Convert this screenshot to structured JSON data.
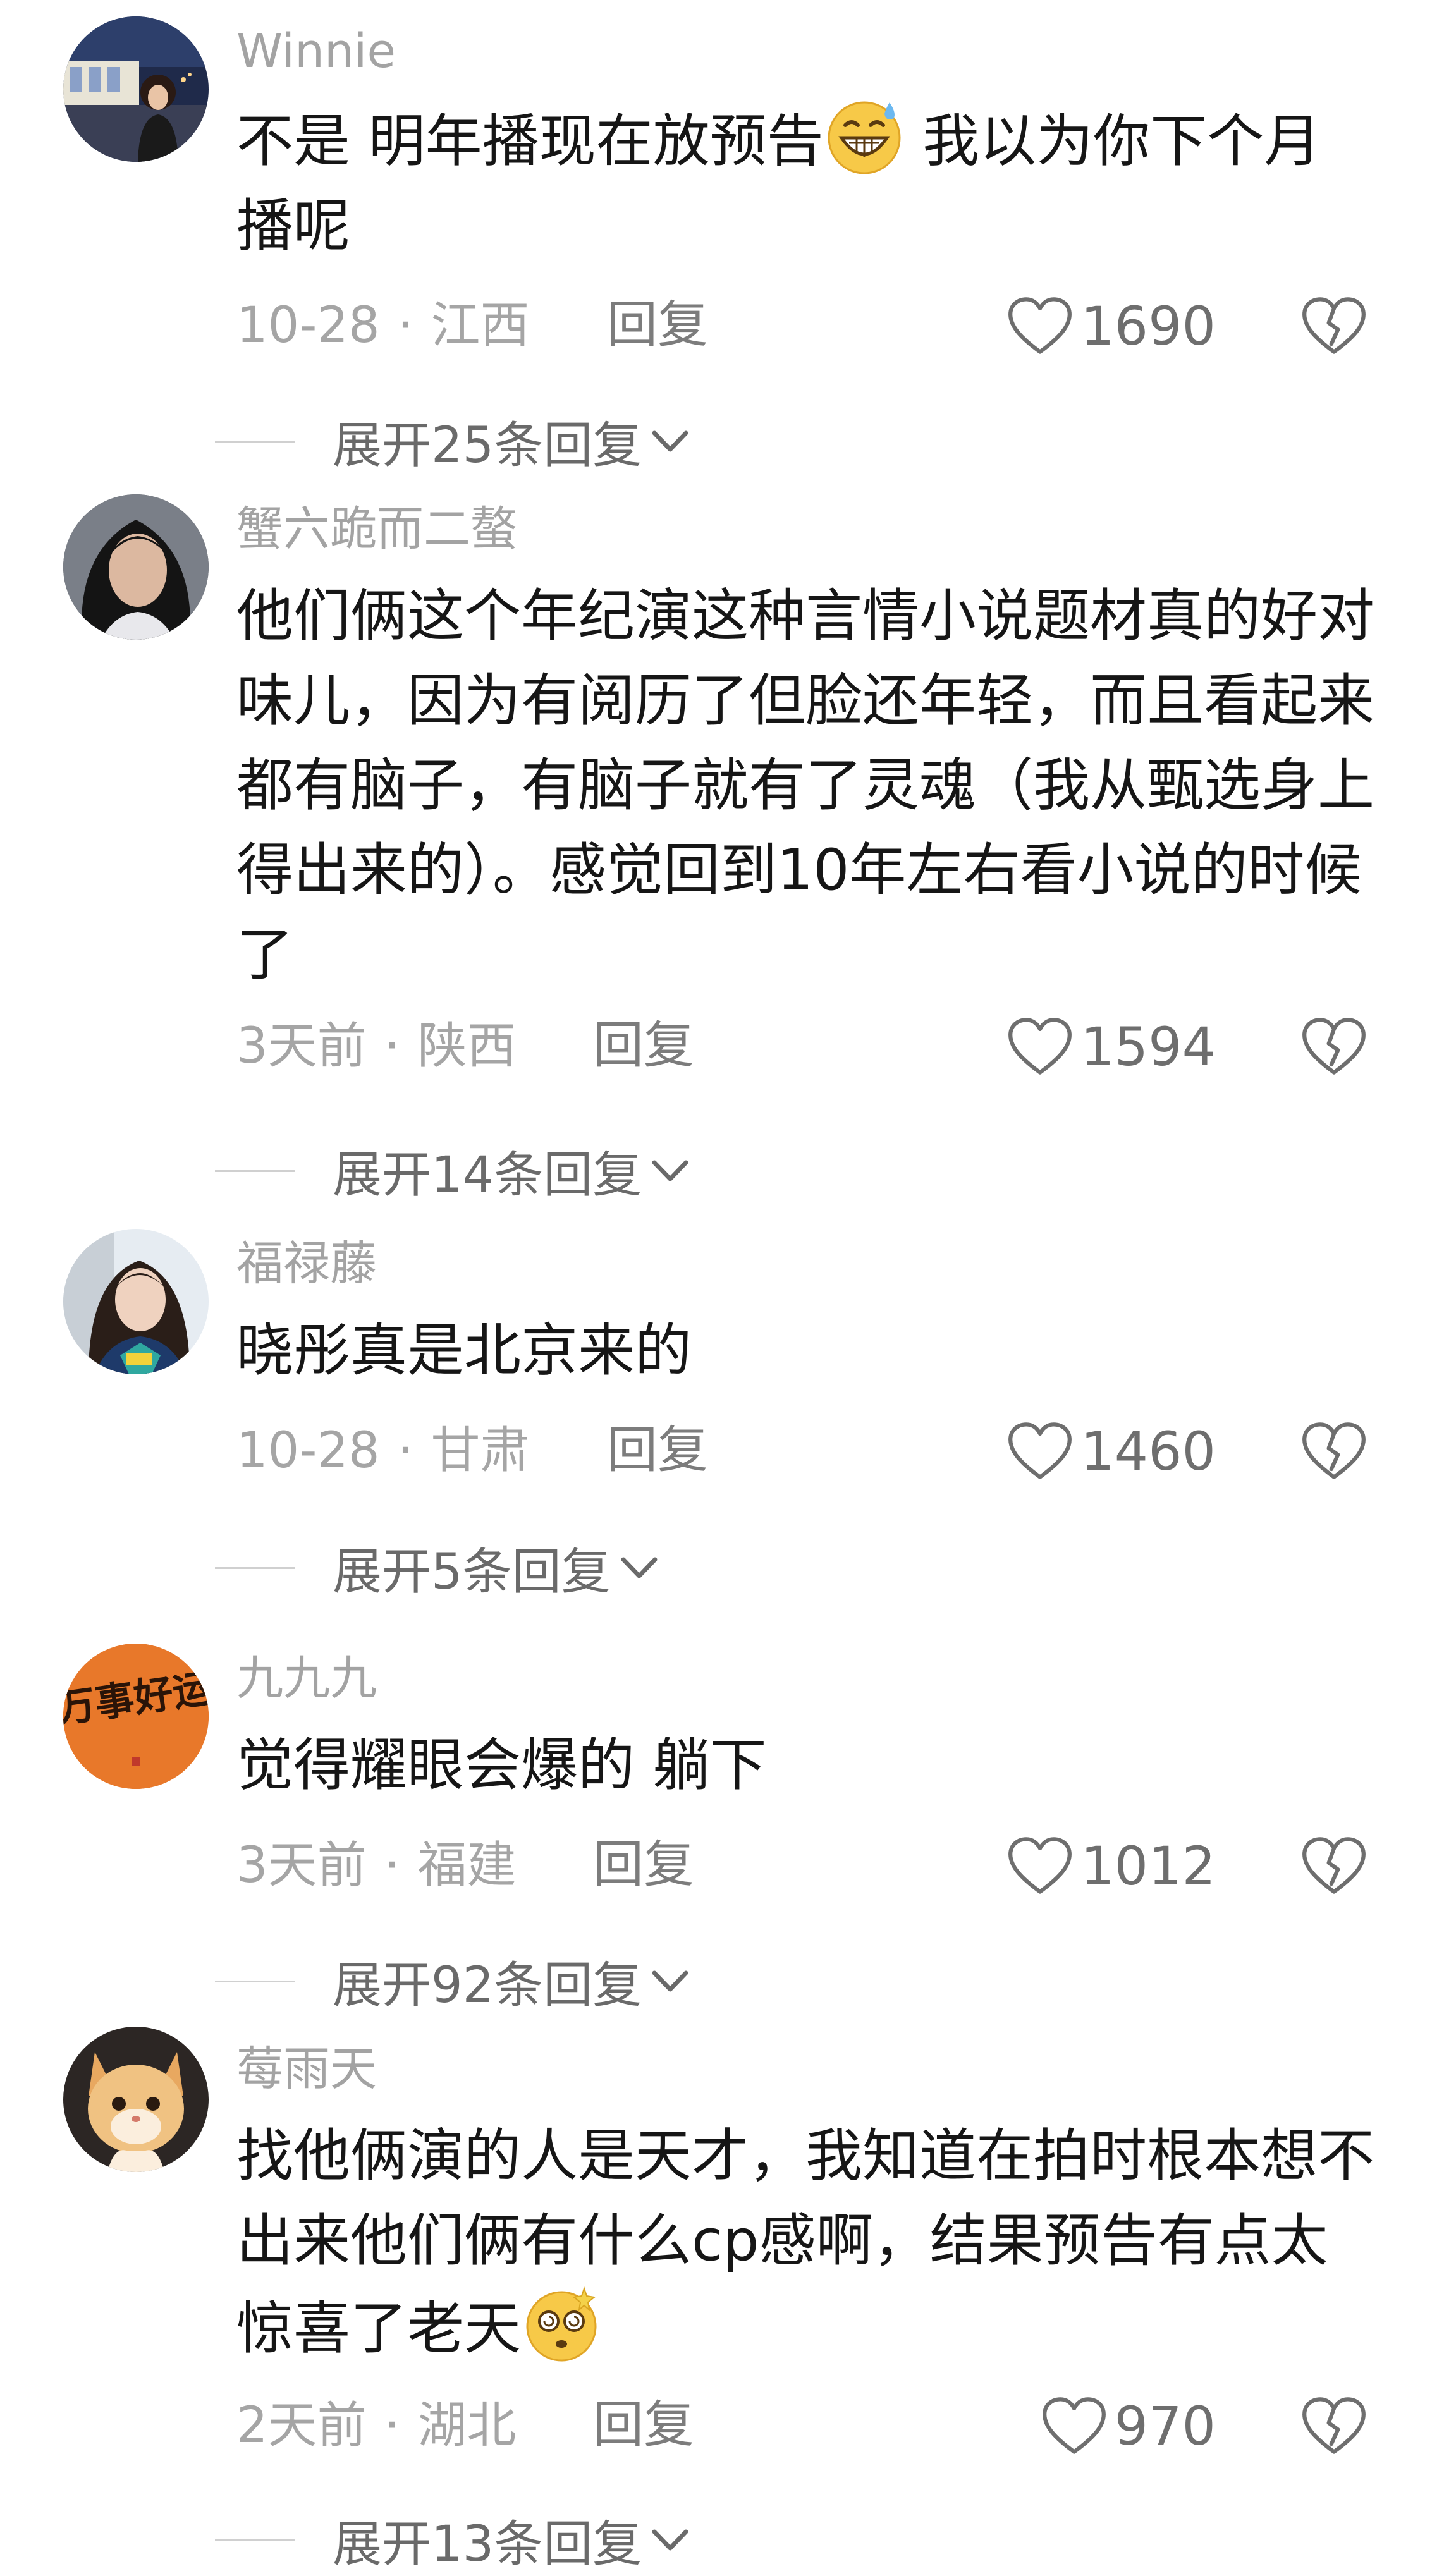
{
  "comments": [
    {
      "username": "Winnie",
      "text_before": "不是 明年播现在放预告",
      "emoji": "grinning-sweat-emoji",
      "text_after": " 我以为你下个月播呢",
      "date": "10-28",
      "location": "江西",
      "reply_label": "回复",
      "likes": "1690",
      "expand_label": "展开25条回复"
    },
    {
      "username": "蟹六跪而二螯",
      "text_before": "他们俩这个年纪演这种言情小说题材真的好对味儿，因为有阅历了但脸还年轻，而且看起来都有脑子，有脑子就有了灵魂（我从甄选身上得出来的）。感觉回到10年左右看小说的时候了",
      "emoji": "",
      "text_after": "",
      "date": "3天前",
      "location": "陕西",
      "reply_label": "回复",
      "likes": "1594",
      "expand_label": "展开14条回复"
    },
    {
      "username": "福禄藤",
      "text_before": "晓彤真是北京来的",
      "emoji": "",
      "text_after": "",
      "date": "10-28",
      "location": "甘肃",
      "reply_label": "回复",
      "likes": "1460",
      "expand_label": "展开5条回复"
    },
    {
      "username": "九九九",
      "text_before": "觉得耀眼会爆的 躺下",
      "emoji": "",
      "text_after": "",
      "date": "3天前",
      "location": "福建",
      "reply_label": "回复",
      "likes": "1012",
      "expand_label": "展开92条回复",
      "avatar_text": "万事好运"
    },
    {
      "username": "莓雨天",
      "text_before": "找他俩演的人是天才，我知道在拍时根本想不出来他们俩有什么cp感啊，结果预告有点太惊喜了老天",
      "emoji": "dizzy-face-emoji",
      "text_after": "",
      "date": "2天前",
      "location": "湖北",
      "reply_label": "回复",
      "likes": "970",
      "expand_label": "展开13条回复"
    }
  ],
  "colors": {
    "username": "#a3a3a3",
    "text": "#161616",
    "meta": "#a5a5a5",
    "icon": "#6e6e6e",
    "avatar_orange": "#e8782a"
  }
}
